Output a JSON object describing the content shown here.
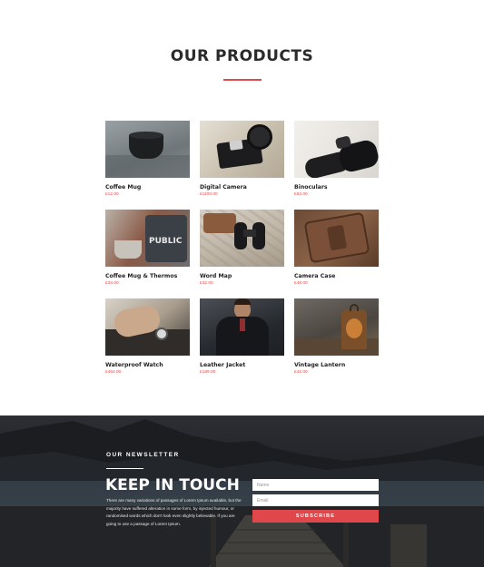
{
  "products_section": {
    "title": "OUR PRODUCTS",
    "items": [
      {
        "name": "Coffee Mug",
        "price": "£12.00",
        "image_icon": "mug-photo-icon"
      },
      {
        "name": "Digital Camera",
        "price": "£1100.00",
        "image_icon": "camera-photo-icon"
      },
      {
        "name": "Binoculars",
        "price": "£62.00",
        "image_icon": "binoculars-photo-icon"
      },
      {
        "name": "Coffee Mug & Thermos",
        "price": "£34.00",
        "image_icon": "thermos-photo-icon"
      },
      {
        "name": "Word Map",
        "price": "£32.00",
        "image_icon": "map-photo-icon"
      },
      {
        "name": "Camera Case",
        "price": "£48.00",
        "image_icon": "camera-case-photo-icon"
      },
      {
        "name": "Waterproof Watch",
        "price": "£464.00",
        "image_icon": "watch-photo-icon"
      },
      {
        "name": "Leather Jacket",
        "price": "£189.00",
        "image_icon": "jacket-photo-icon"
      },
      {
        "name": "Vintage Lantern",
        "price": "£42.00",
        "image_icon": "lantern-photo-icon"
      }
    ]
  },
  "newsletter": {
    "label": "OUR NEWSLETTER",
    "heading": "KEEP IN TOUCH",
    "body": "There are many variations of passages of Lorem Ipsum available, but the majority have suffered alteration in some form, by injected humour, or randomised words which don't look even slightly believable. If you are going to use a passage of Lorem Ipsum.",
    "name_placeholder": "Name",
    "email_placeholder": "Email",
    "subscribe_label": "SUBSCRIBE"
  },
  "colors": {
    "accent": "#e04b4b",
    "heading_dark": "#2b2b2b",
    "button": "#e0474b"
  }
}
